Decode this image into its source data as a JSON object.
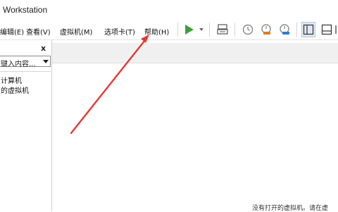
{
  "app": {
    "title": "Workstation"
  },
  "menu": {
    "items": [
      {
        "label": "编辑(E)"
      },
      {
        "label": "查看(V)"
      },
      {
        "label": "虚拟机(M)"
      },
      {
        "label": "选项卡(T)"
      },
      {
        "label": "帮助(H)"
      }
    ]
  },
  "toolbar": {
    "buttons": [
      {
        "icon": "play-icon",
        "color": "#3aa13a"
      },
      {
        "icon": "send-keys-icon"
      },
      {
        "icon": "snapshot-icon"
      },
      {
        "icon": "snapshot-revert-icon",
        "color": "#e07a1f"
      },
      {
        "icon": "snapshot-manager-icon",
        "color": "#2e7bd6"
      },
      {
        "icon": "sidebar-view-icon"
      },
      {
        "icon": "thumbnail-view-icon"
      },
      {
        "icon": "fullscreen-icon"
      }
    ]
  },
  "library": {
    "close_label": "x",
    "search_placeholder": "键入内容...",
    "items": [
      {
        "label": "计算机"
      },
      {
        "label": "的虚拟机"
      }
    ]
  },
  "main": {
    "status_text": "没有打开的虚拟机。请在虚"
  },
  "annotation": {
    "color": "#e53935"
  }
}
